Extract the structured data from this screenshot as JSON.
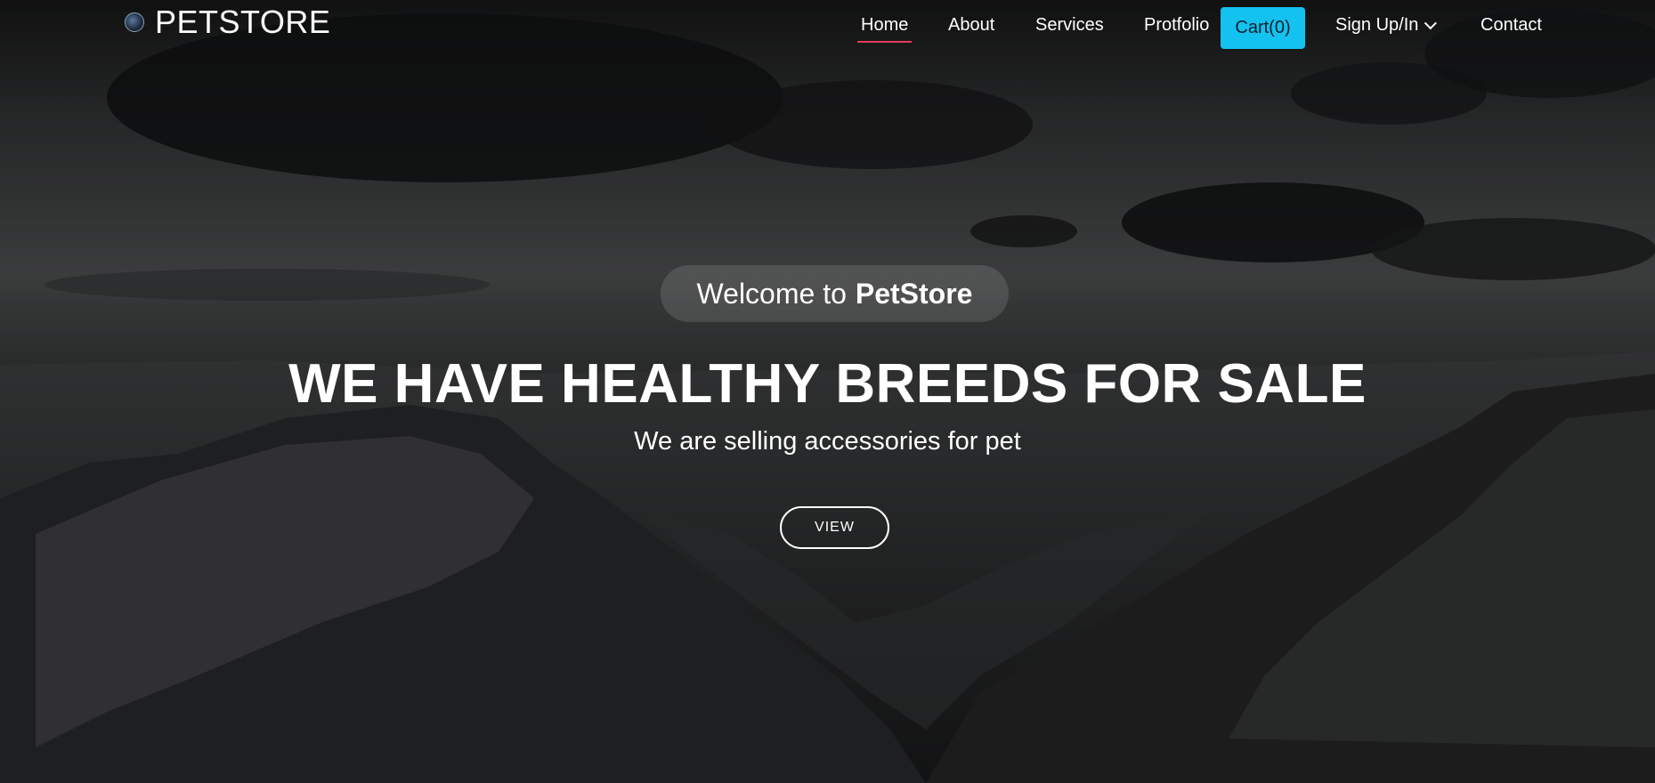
{
  "brand": {
    "name": "PETSTORE",
    "logo_icon": "globe-icon"
  },
  "nav": {
    "home": "Home",
    "about": "About",
    "services": "Services",
    "portfolio": "Protfolio",
    "cart": "Cart(0)",
    "signin": "Sign Up/In",
    "contact": "Contact"
  },
  "hero": {
    "welcome_prefix": "Welcome to",
    "welcome_brand": "PetStore",
    "headline": "WE HAVE HEALTHY BREEDS FOR SALE",
    "subline": "We are selling accessories for pet",
    "cta": "VIEW"
  },
  "colors": {
    "accent_underline": "#e43c5c",
    "cart_bg": "#14c2ef"
  }
}
